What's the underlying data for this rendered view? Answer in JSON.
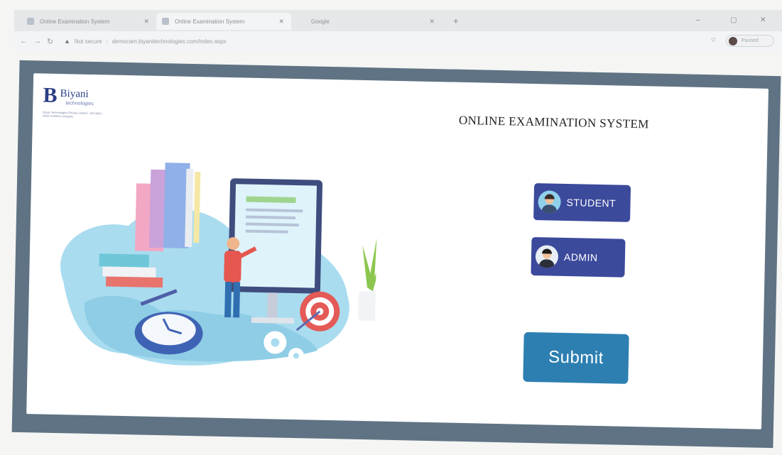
{
  "browser": {
    "tabs": [
      {
        "title": "Online Examination System",
        "active": false
      },
      {
        "title": "Online Examination System",
        "active": true
      },
      {
        "title": "Google",
        "active": false
      }
    ],
    "address": {
      "security": "Not secure",
      "url": "democam.biyanitechnologies.com/index.aspx"
    },
    "profile_label": "Paused"
  },
  "page": {
    "logo": {
      "brand": "Biyani",
      "sub": "technologies",
      "fine": "Biyani Technologies Private Limited · ISO 9001 : 2008 Certified Company"
    },
    "headline": "ONLINE EXAMINATION SYSTEM",
    "buttons": {
      "student": "STUDENT",
      "admin": "ADMIN",
      "submit": "Submit"
    }
  },
  "colors": {
    "frame": "#5f7384",
    "role_button": "#3c4a9c",
    "submit_button": "#2d7fb1",
    "logo": "#2a3e84"
  }
}
